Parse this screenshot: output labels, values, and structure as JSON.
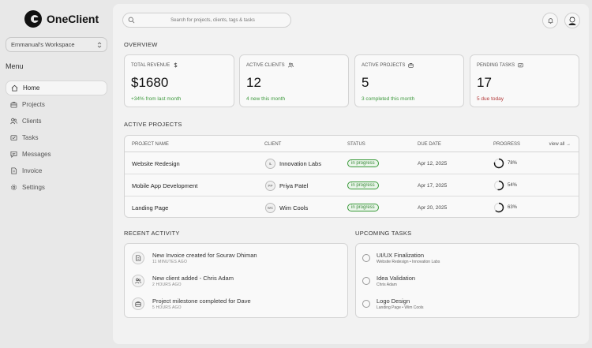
{
  "brand": {
    "name": "OneClient"
  },
  "workspace": {
    "name": "Emmanual's Workspace"
  },
  "sidebar": {
    "menu_title": "Menu",
    "items": [
      {
        "label": "Home",
        "icon": "home-icon",
        "active": true
      },
      {
        "label": "Projects",
        "icon": "briefcase-icon"
      },
      {
        "label": "Clients",
        "icon": "users-icon"
      },
      {
        "label": "Tasks",
        "icon": "tasks-icon"
      },
      {
        "label": "Messages",
        "icon": "message-icon"
      },
      {
        "label": "Invoice",
        "icon": "invoice-icon"
      },
      {
        "label": "Settings",
        "icon": "gear-icon"
      }
    ]
  },
  "search": {
    "placeholder": "Search for projects, clients, tags & tasks"
  },
  "overview": {
    "title": "OVERVIEW",
    "stats": [
      {
        "label": "TOTAL REVENUE",
        "icon": "dollar-icon",
        "value": "$1680",
        "sub": "+34% from last month",
        "sub_color": "#3f9a3f"
      },
      {
        "label": "ACTIVE CLIENTS",
        "icon": "users-icon",
        "value": "12",
        "sub": "4 new this month",
        "sub_color": "#3f9a3f"
      },
      {
        "label": "ACTIVE PROJECTS",
        "icon": "briefcase-icon",
        "value": "5",
        "sub": "3 completed this month",
        "sub_color": "#3f9a3f"
      },
      {
        "label": "PENDING TASKS",
        "icon": "tasks-icon",
        "value": "17",
        "sub": "5 due today",
        "sub_color": "#b33a3a"
      }
    ]
  },
  "projects": {
    "title": "ACTIVE PROJECTS",
    "view_all": "view all →",
    "columns": [
      "PROJECT NAME",
      "CLIENT",
      "STATUS",
      "DUE DATE",
      "PROGRESS"
    ],
    "rows": [
      {
        "name": "Website Redesign",
        "client_initials": "IL",
        "client": "Innovation Labs",
        "status": "in progress",
        "due": "Apr 12, 2025",
        "progress": 78,
        "progress_label": "78%"
      },
      {
        "name": "Mobile App Development",
        "client_initials": "PP",
        "client": "Priya Patel",
        "status": "in progress",
        "due": "Apr 17, 2025",
        "progress": 54,
        "progress_label": "54%"
      },
      {
        "name": "Landing Page",
        "client_initials": "WC",
        "client": "Wim Cools",
        "status": "in progress",
        "due": "Apr 20, 2025",
        "progress": 63,
        "progress_label": "63%"
      }
    ]
  },
  "activity": {
    "title": "RECENT ACTIVITY",
    "items": [
      {
        "title": "New Invoice created for Sourav Dhiman",
        "time": "11 MINUTES AGO",
        "icon": "invoice-icon"
      },
      {
        "title": "New client added - Chris Adam",
        "time": "2 HOURS AGO",
        "icon": "users-icon"
      },
      {
        "title": "Project milestone completed for Dave",
        "time": "5 HOURS AGO",
        "icon": "briefcase-icon"
      }
    ]
  },
  "tasks": {
    "title": "UPCOMING TASKS",
    "items": [
      {
        "title": "UI/UX Finalization",
        "sub": "Website Redesign  •  Innovation Labs"
      },
      {
        "title": "Idea Validation",
        "sub": "Chris Adam"
      },
      {
        "title": "Logo Design",
        "sub": "Landing Page  •  Wim Cools"
      }
    ]
  }
}
